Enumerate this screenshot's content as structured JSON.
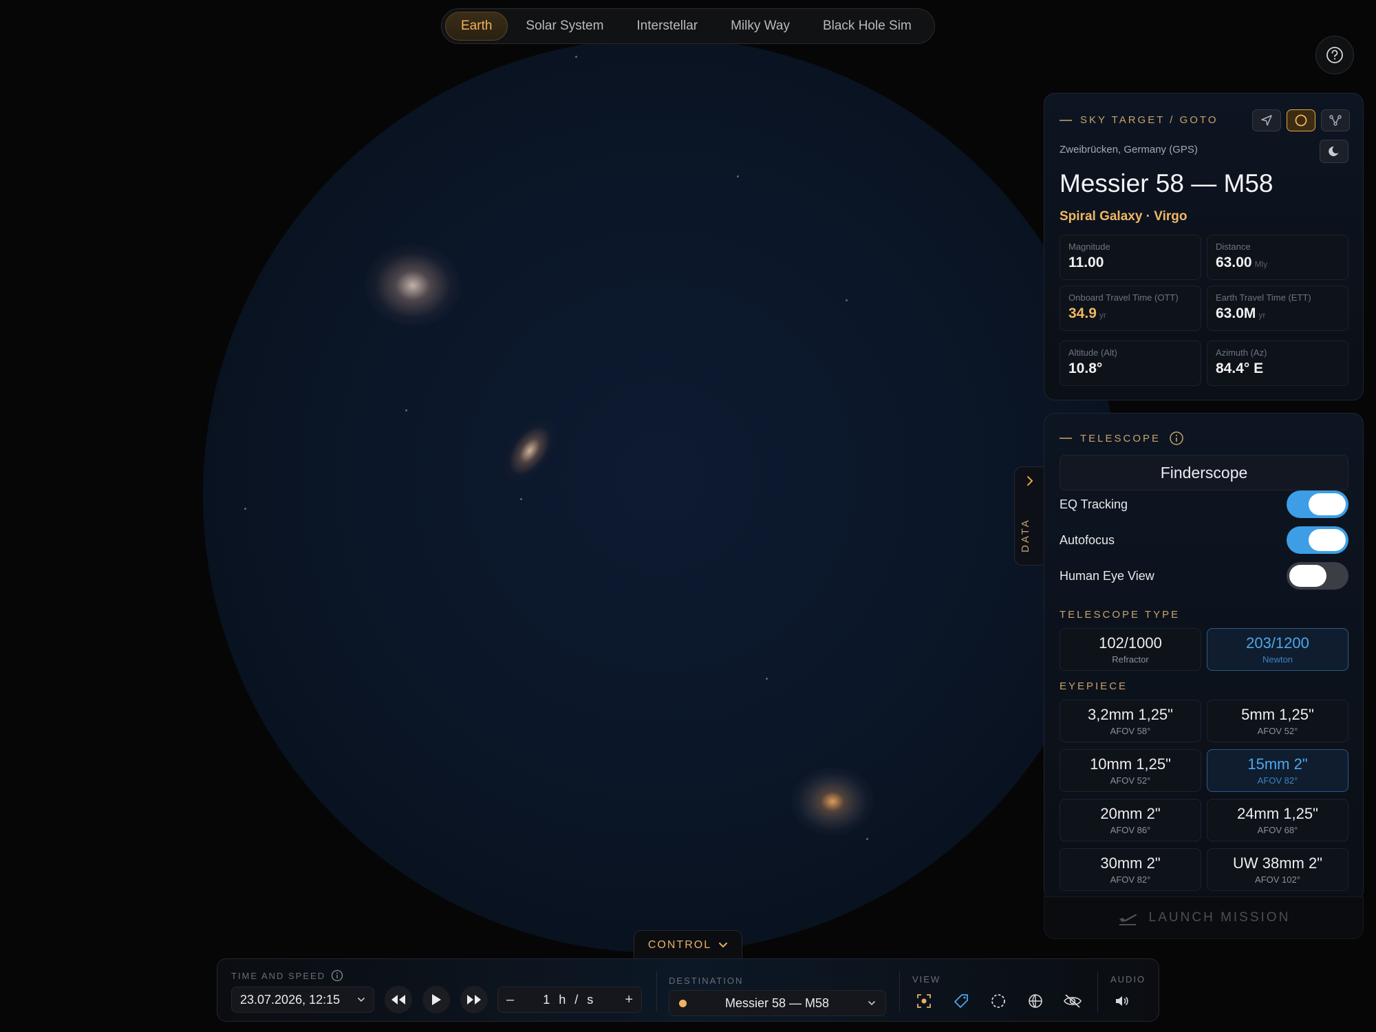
{
  "nav": {
    "tabs": [
      {
        "label": "Earth",
        "active": true
      },
      {
        "label": "Solar System",
        "active": false
      },
      {
        "label": "Interstellar",
        "active": false
      },
      {
        "label": "Milky Way",
        "active": false
      },
      {
        "label": "Black Hole Sim",
        "active": false
      }
    ]
  },
  "help": {
    "icon": "question-circle-icon"
  },
  "target": {
    "section_title": "SKY TARGET / GOTO",
    "location": "Zweibrücken, Germany (GPS)",
    "name": "Messier 58 — M58",
    "subtitle": "Spiral Galaxy · Virgo",
    "mode_buttons": [
      "navigate-icon",
      "circle-icon",
      "constellation-icon"
    ],
    "night_mode_icon": "moon-icon",
    "stats": {
      "magnitude": {
        "label": "Magnitude",
        "value": "11.00",
        "unit": ""
      },
      "distance": {
        "label": "Distance",
        "value": "63.00",
        "unit": "Mly"
      },
      "ott": {
        "label": "Onboard Travel Time (OTT)",
        "value": "34.9",
        "unit": "yr"
      },
      "ett": {
        "label": "Earth Travel Time (ETT)",
        "value": "63.0M",
        "unit": "yr"
      },
      "alt": {
        "label": "Altitude (Alt)",
        "value": "10.8°",
        "unit": ""
      },
      "az": {
        "label": "Azimuth (Az)",
        "value": "84.4° E",
        "unit": ""
      }
    }
  },
  "telescope": {
    "section_title": "TELESCOPE",
    "finder_label": "Finderscope",
    "toggles": {
      "eq": {
        "label": "EQ Tracking",
        "on": true
      },
      "autofocus": {
        "label": "Autofocus",
        "on": true
      },
      "human_eye": {
        "label": "Human Eye View",
        "on": false
      }
    },
    "type_title": "TELESCOPE TYPE",
    "types": [
      {
        "main": "102/1000",
        "sub": "Refractor",
        "selected": false
      },
      {
        "main": "203/1200",
        "sub": "Newton",
        "selected": true
      }
    ],
    "eyepiece_title": "EYEPIECE",
    "eyepieces": [
      {
        "main": "3,2mm 1,25\"",
        "sub": "AFOV 58°",
        "selected": false
      },
      {
        "main": "5mm 1,25\"",
        "sub": "AFOV 52°",
        "selected": false
      },
      {
        "main": "10mm 1,25\"",
        "sub": "AFOV 52°",
        "selected": false
      },
      {
        "main": "15mm 2\"",
        "sub": "AFOV 82°",
        "selected": true
      },
      {
        "main": "20mm 2\"",
        "sub": "AFOV 86°",
        "selected": false
      },
      {
        "main": "24mm 1,25\"",
        "sub": "AFOV 68°",
        "selected": false
      },
      {
        "main": "30mm 2\"",
        "sub": "AFOV 82°",
        "selected": false
      },
      {
        "main": "UW 38mm 2\"",
        "sub": "AFOV 102°",
        "selected": false
      }
    ]
  },
  "launch": {
    "label": "LAUNCH MISSION",
    "icon": "plane-takeoff-icon"
  },
  "data_tab": {
    "label": "DATA"
  },
  "control": {
    "toggle_label": "CONTROL",
    "time_label": "TIME AND SPEED",
    "datetime": "23.07.2026, 12:15",
    "speed": "1 h / s",
    "destination_label": "DESTINATION",
    "destination": "Messier 58 — M58",
    "view_label": "VIEW",
    "audio_label": "AUDIO",
    "view_icons": [
      "target-focus-icon",
      "tag-icon",
      "dashed-circle-icon",
      "globe-grid-icon",
      "eye-off-icon"
    ],
    "audio_icon": "speaker-icon"
  },
  "colors": {
    "accent": "#f2b35d",
    "blue": "#3d9ee6",
    "background": "#060607"
  }
}
